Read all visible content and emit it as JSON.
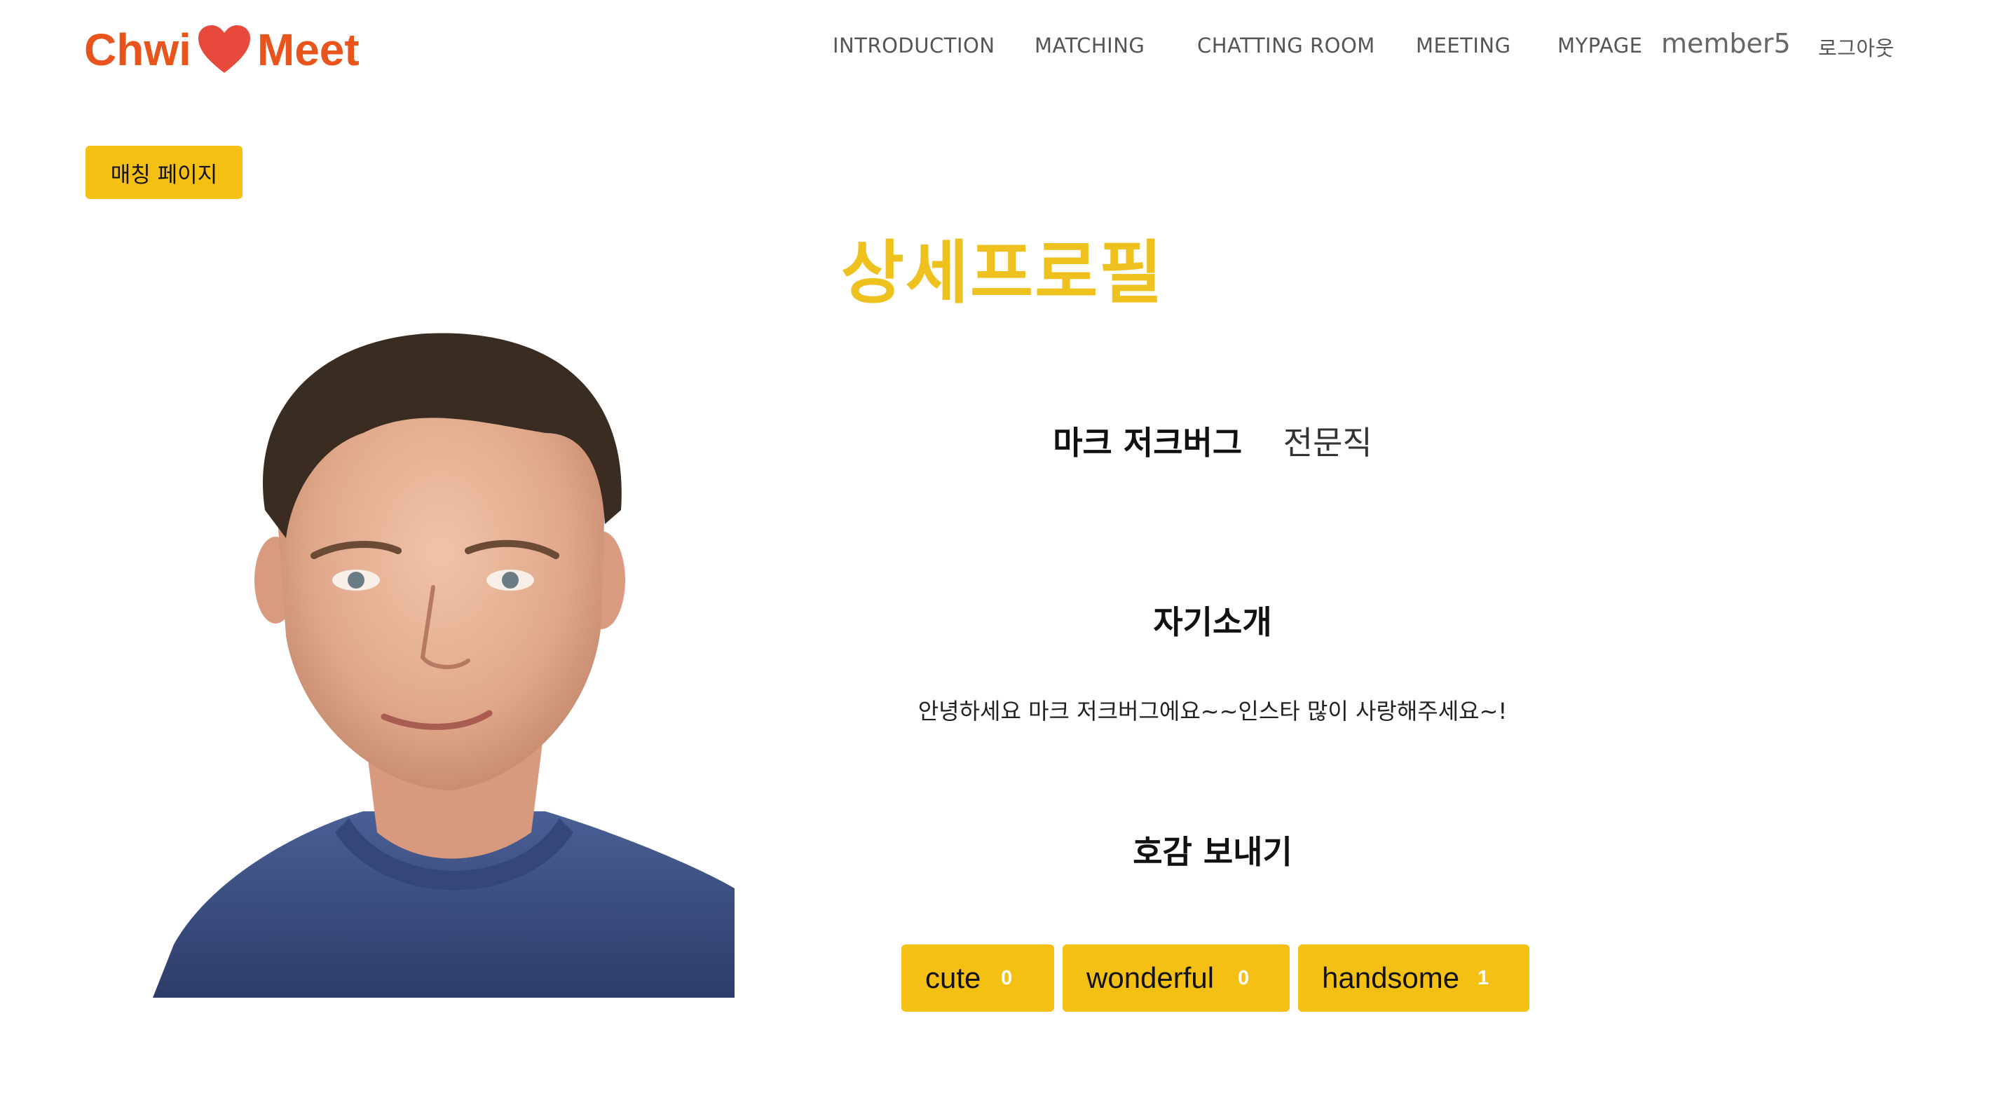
{
  "header": {
    "logo": {
      "left_word": "Chwi",
      "right_word": "Meet"
    },
    "nav": [
      "INTRODUCTION",
      "MATCHING",
      "CHATTING ROOM",
      "MEETING",
      "MYPAGE"
    ],
    "username": "member5",
    "logout": "로그아웃"
  },
  "back_button": "매칭 페이지",
  "page_title": "상세프로필",
  "profile": {
    "name": "마크 저크버그",
    "job": "전문직",
    "intro_heading": "자기소개",
    "intro_text": "안녕하세요 마크 저크버그에요~~인스타 많이 사랑해주세요~!",
    "like_heading": "호감 보내기",
    "likes": [
      {
        "label": "cute",
        "count": "0"
      },
      {
        "label": "wonderful",
        "count": "0"
      },
      {
        "label": "handsome",
        "count": "1"
      }
    ]
  },
  "colors": {
    "accent": "#f5c014",
    "title": "#eec11f",
    "logo": "#e8541c",
    "heart": "#e74a3b"
  },
  "icons": {
    "logo_heart": "heart-icon"
  }
}
